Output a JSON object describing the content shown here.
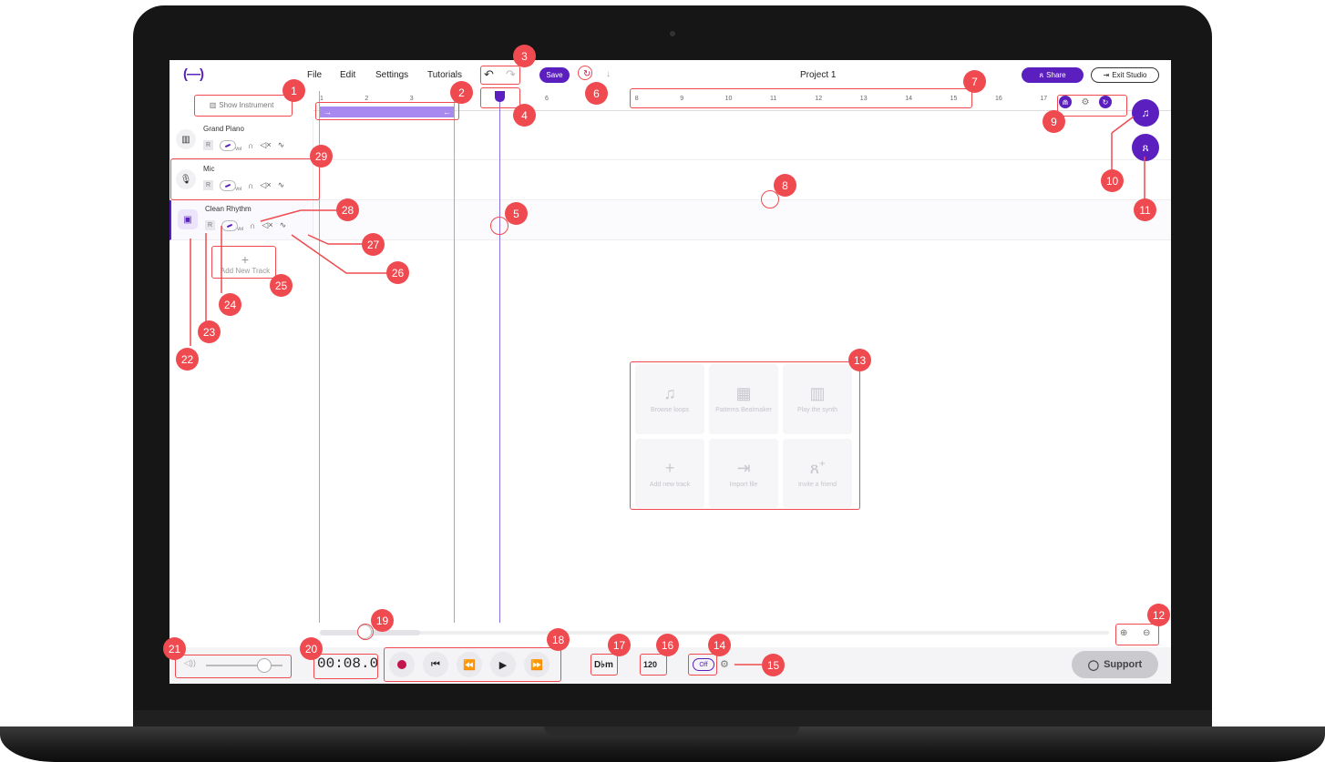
{
  "app": {
    "logo": "(—)",
    "menu": [
      "File",
      "Edit",
      "Settings",
      "Tutorials"
    ],
    "save_label": "Save",
    "project_title": "Project 1",
    "share_label": "Share",
    "exit_label": "Exit Studio",
    "show_instrument": "Show Instrument"
  },
  "ruler": [
    "1",
    "2",
    "3",
    "4",
    "5",
    "6",
    "7",
    "8",
    "9",
    "10",
    "11",
    "12",
    "13",
    "14",
    "15",
    "16",
    "17"
  ],
  "loop": {
    "left_arrow": "→",
    "right_arrow": "←"
  },
  "tracks": [
    {
      "name": "Grand Piano",
      "icon": "piano-icon",
      "r": "R",
      "vol": "Vol"
    },
    {
      "name": "Mic",
      "icon": "mic-icon",
      "r": "R",
      "vol": "Vol"
    },
    {
      "name": "Clean Rhythm",
      "icon": "guitar-amp-icon",
      "r": "R",
      "vol": "Vol"
    }
  ],
  "add_track": "Add New Track",
  "quick_actions": [
    {
      "label": "Browse loops",
      "icon": "music-note-icon"
    },
    {
      "label": "Patterns Beatmaker",
      "icon": "grid-pads-icon"
    },
    {
      "label": "Play the synth",
      "icon": "keyboard-icon"
    },
    {
      "label": "Add new track",
      "icon": "plus-icon"
    },
    {
      "label": "Import file",
      "icon": "import-icon"
    },
    {
      "label": "Invite a friend",
      "icon": "invite-icon"
    }
  ],
  "footer": {
    "time": "00:08.0",
    "key": "D♭m",
    "bpm": "120",
    "metronome": "Off",
    "support": "Support"
  },
  "annotations": [
    "1",
    "2",
    "3",
    "4",
    "5",
    "6",
    "7",
    "8",
    "9",
    "10",
    "11",
    "12",
    "13",
    "14",
    "15",
    "16",
    "17",
    "18",
    "19",
    "20",
    "21",
    "22",
    "23",
    "24",
    "25",
    "26",
    "27",
    "28",
    "29"
  ],
  "colors": {
    "accent": "#5b1fbf",
    "annotation": "#ef4a4f",
    "record": "#c2154b"
  }
}
